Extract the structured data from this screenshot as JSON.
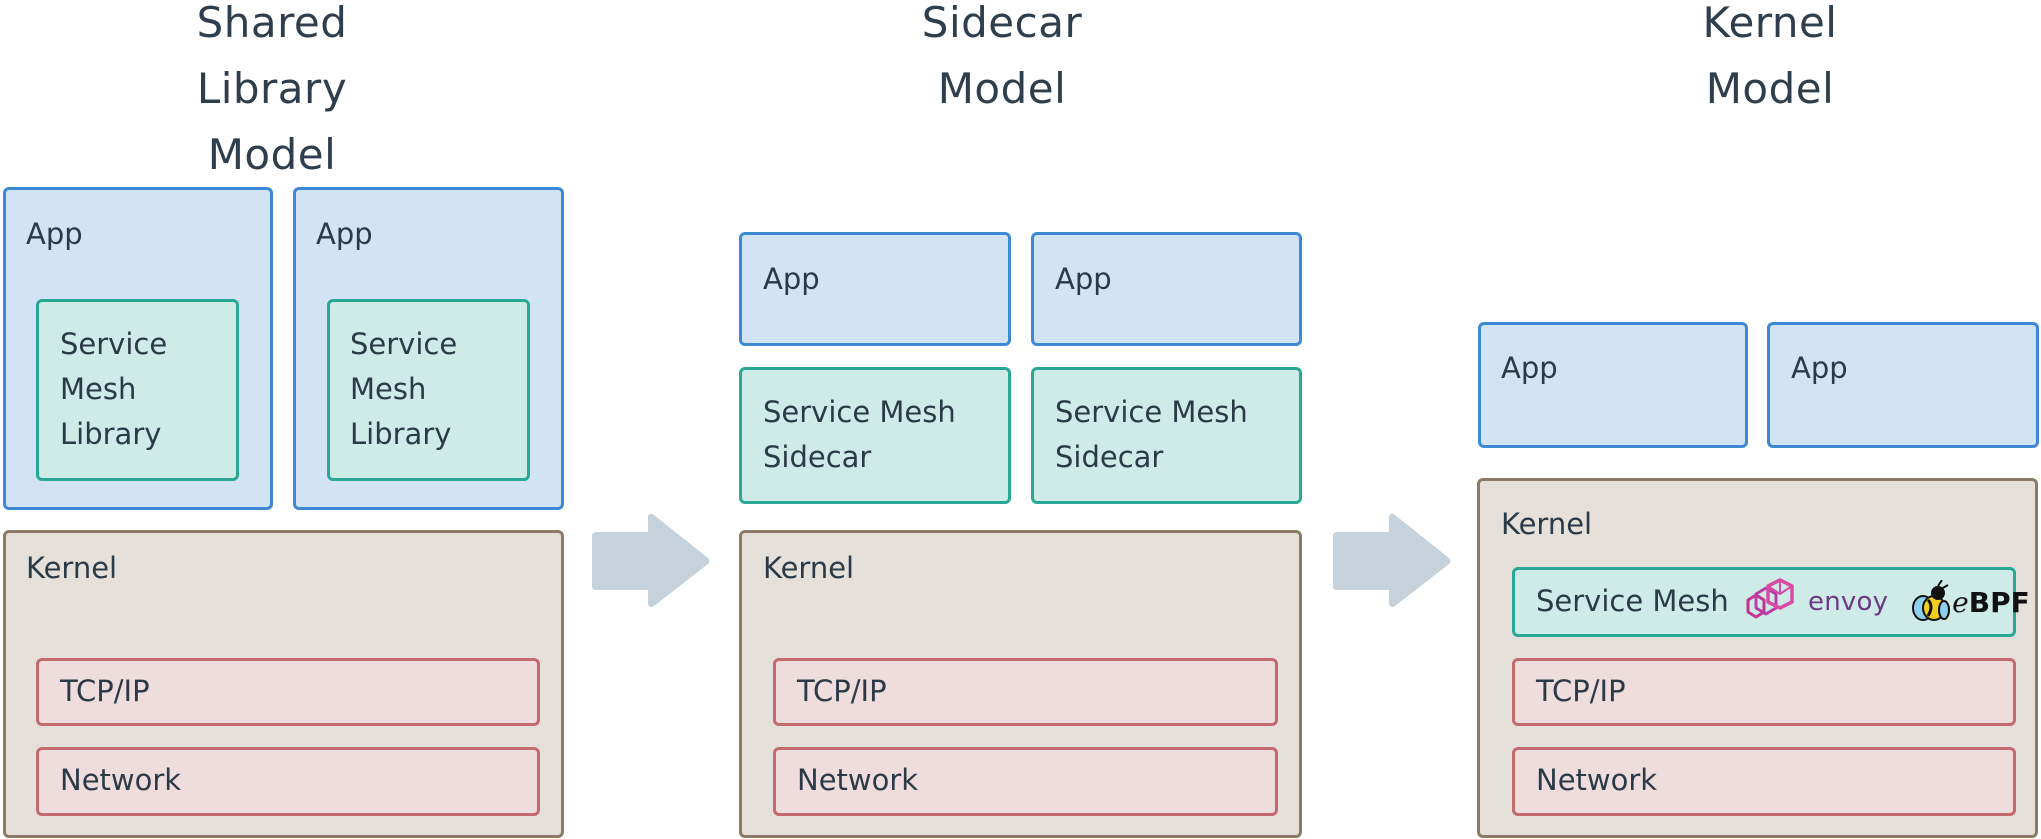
{
  "diagram": {
    "columns": [
      {
        "title_lines": [
          "Shared Library",
          "Model"
        ],
        "apps": [
          {
            "label": "App",
            "inner_lines": [
              "Service",
              "Mesh",
              "Library"
            ]
          },
          {
            "label": "App",
            "inner_lines": [
              "Service",
              "Mesh",
              "Library"
            ]
          }
        ],
        "kernel": {
          "label": "Kernel",
          "layers": [
            "TCP/IP",
            "Network"
          ]
        }
      },
      {
        "title_lines": [
          "Sidecar",
          "Model"
        ],
        "apps": [
          {
            "label": "App",
            "sidecar_lines": [
              "Service Mesh",
              "Sidecar"
            ]
          },
          {
            "label": "App",
            "sidecar_lines": [
              "Service Mesh",
              "Sidecar"
            ]
          }
        ],
        "kernel": {
          "label": "Kernel",
          "layers": [
            "TCP/IP",
            "Network"
          ]
        }
      },
      {
        "title_lines": [
          "Kernel",
          "Model"
        ],
        "apps": [
          {
            "label": "App"
          },
          {
            "label": "App"
          }
        ],
        "kernel": {
          "label": "Kernel",
          "service_mesh": {
            "label": "Service Mesh",
            "logos": [
              {
                "icon": "envoy-logo-icon",
                "text": "envoy"
              },
              {
                "icon": "ebpf-bee-icon",
                "text_prefix": "e",
                "text": "BPF"
              }
            ]
          },
          "layers": [
            "TCP/IP",
            "Network"
          ]
        }
      }
    ],
    "arrows": [
      {
        "from": "Shared Library Model",
        "to": "Sidecar Model",
        "icon": "right-arrow-icon"
      },
      {
        "from": "Sidecar Model",
        "to": "Kernel Model",
        "icon": "right-arrow-icon"
      }
    ],
    "colors": {
      "app_fill": "#d2e3f5",
      "app_border": "#3e89d6",
      "mesh_fill": "#cfebe8",
      "mesh_border": "#2aa896",
      "kernel_fill": "#e5e1da",
      "kernel_border": "#8c7c64",
      "net_fill": "#efdcdc",
      "net_border": "#c46a6f",
      "arrow": "#c5d1db",
      "text": "#2b3a47"
    }
  }
}
